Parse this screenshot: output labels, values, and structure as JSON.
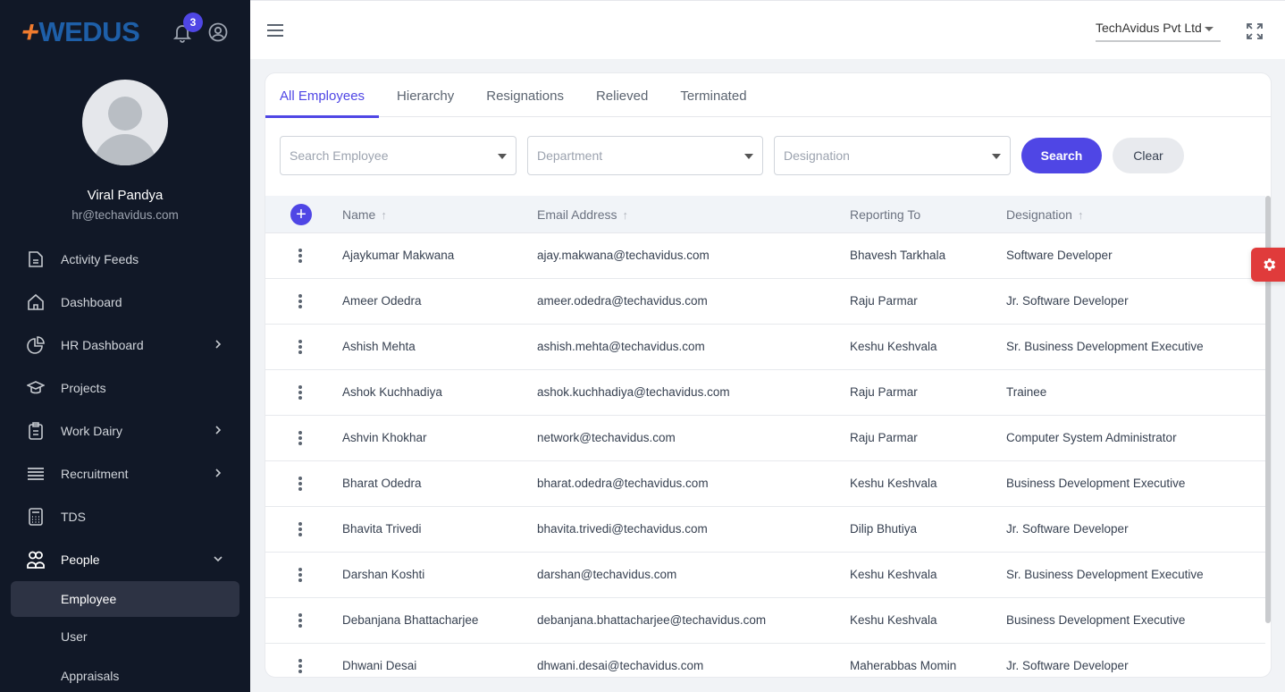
{
  "brand": {
    "logo_text": "WEDUS",
    "logo_mark": "+",
    "notification_count": "3"
  },
  "user": {
    "name": "Viral Pandya",
    "email": "hr@techavidus.com"
  },
  "sidebar": {
    "items": [
      {
        "label": "Activity Feeds",
        "icon": "document-icon",
        "has_children": false
      },
      {
        "label": "Dashboard",
        "icon": "home-icon",
        "has_children": false
      },
      {
        "label": "HR Dashboard",
        "icon": "pie-chart-icon",
        "has_children": true
      },
      {
        "label": "Projects",
        "icon": "graduation-cap-icon",
        "has_children": false
      },
      {
        "label": "Work Dairy",
        "icon": "clipboard-icon",
        "has_children": true
      },
      {
        "label": "Recruitment",
        "icon": "list-icon",
        "has_children": true
      },
      {
        "label": "TDS",
        "icon": "calculator-icon",
        "has_children": false
      },
      {
        "label": "People",
        "icon": "users-icon",
        "has_children": true,
        "expanded": true
      }
    ],
    "sub_items": [
      {
        "label": "Employee",
        "active": true
      },
      {
        "label": "User",
        "active": false
      },
      {
        "label": "Appraisals",
        "active": false
      }
    ]
  },
  "topbar": {
    "company": "TechAvidus Pvt Ltd"
  },
  "tabs": [
    {
      "label": "All Employees",
      "active": true
    },
    {
      "label": "Hierarchy",
      "active": false
    },
    {
      "label": "Resignations",
      "active": false
    },
    {
      "label": "Relieved",
      "active": false
    },
    {
      "label": "Terminated",
      "active": false
    }
  ],
  "filters": {
    "employee_placeholder": "Search Employee",
    "department_placeholder": "Department",
    "designation_placeholder": "Designation",
    "search_label": "Search",
    "clear_label": "Clear"
  },
  "table": {
    "columns": [
      {
        "label": "Name",
        "sortable": true,
        "sort_icon": "↑"
      },
      {
        "label": "Email Address",
        "sortable": true,
        "sort_icon": "↑"
      },
      {
        "label": "Reporting To",
        "sortable": false,
        "sort_icon": ""
      },
      {
        "label": "Designation",
        "sortable": true,
        "sort_icon": "↑"
      }
    ],
    "rows": [
      {
        "name": "Ajaykumar Makwana",
        "email": "ajay.makwana@techavidus.com",
        "reporting_to": "Bhavesh Tarkhala",
        "designation": "Software Developer"
      },
      {
        "name": "Ameer Odedra",
        "email": "ameer.odedra@techavidus.com",
        "reporting_to": "Raju Parmar",
        "designation": "Jr. Software Developer"
      },
      {
        "name": "Ashish Mehta",
        "email": "ashish.mehta@techavidus.com",
        "reporting_to": "Keshu Keshvala",
        "designation": "Sr. Business Development Executive"
      },
      {
        "name": "Ashok Kuchhadiya",
        "email": "ashok.kuchhadiya@techavidus.com",
        "reporting_to": "Raju Parmar",
        "designation": "Trainee"
      },
      {
        "name": "Ashvin Khokhar",
        "email": "network@techavidus.com",
        "reporting_to": "Raju Parmar",
        "designation": "Computer System Administrator"
      },
      {
        "name": "Bharat Odedra",
        "email": "bharat.odedra@techavidus.com",
        "reporting_to": "Keshu Keshvala",
        "designation": "Business Development Executive"
      },
      {
        "name": "Bhavita Trivedi",
        "email": "bhavita.trivedi@techavidus.com",
        "reporting_to": "Dilip Bhutiya",
        "designation": "Jr. Software Developer"
      },
      {
        "name": "Darshan Koshti",
        "email": "darshan@techavidus.com",
        "reporting_to": "Keshu Keshvala",
        "designation": "Sr. Business Development Executive"
      },
      {
        "name": "Debanjana Bhattacharjee",
        "email": "debanjana.bhattacharjee@techavidus.com",
        "reporting_to": "Keshu Keshvala",
        "designation": "Business Development Executive"
      },
      {
        "name": "Dhwani Desai",
        "email": "dhwani.desai@techavidus.com",
        "reporting_to": "Maherabbas Momin",
        "designation": "Jr. Software Developer"
      }
    ]
  },
  "colors": {
    "accent": "#4f46e5",
    "sidebar_bg": "#111827",
    "settings_fab": "#e03b3b",
    "logo_orange": "#f07b2e",
    "logo_blue": "#1e5fa8"
  }
}
